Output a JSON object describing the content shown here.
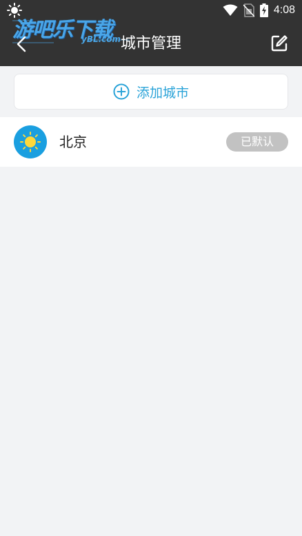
{
  "status_bar": {
    "time": "4:08",
    "icons": [
      "weather-sun-icon",
      "wifi-icon",
      "no-sim-icon",
      "battery-charging-icon"
    ]
  },
  "watermark": {
    "text": "游吧乐下载",
    "sub": "yBL.com"
  },
  "header": {
    "title": "城市管理",
    "back_icon": "chevron-left-icon",
    "edit_icon": "edit-icon"
  },
  "add_city": {
    "label": "添加城市",
    "icon": "plus-circle-icon"
  },
  "cities": [
    {
      "name": "北京",
      "badge": "已默认",
      "icon": "sunny-icon"
    }
  ],
  "colors": {
    "header_bg": "#333333",
    "page_bg": "#f2f3f5",
    "accent": "#2aa3d8",
    "weather_icon_bg": "#1a9fe0",
    "sun": "#ffd83a",
    "badge_bg": "#c2c2c2"
  }
}
